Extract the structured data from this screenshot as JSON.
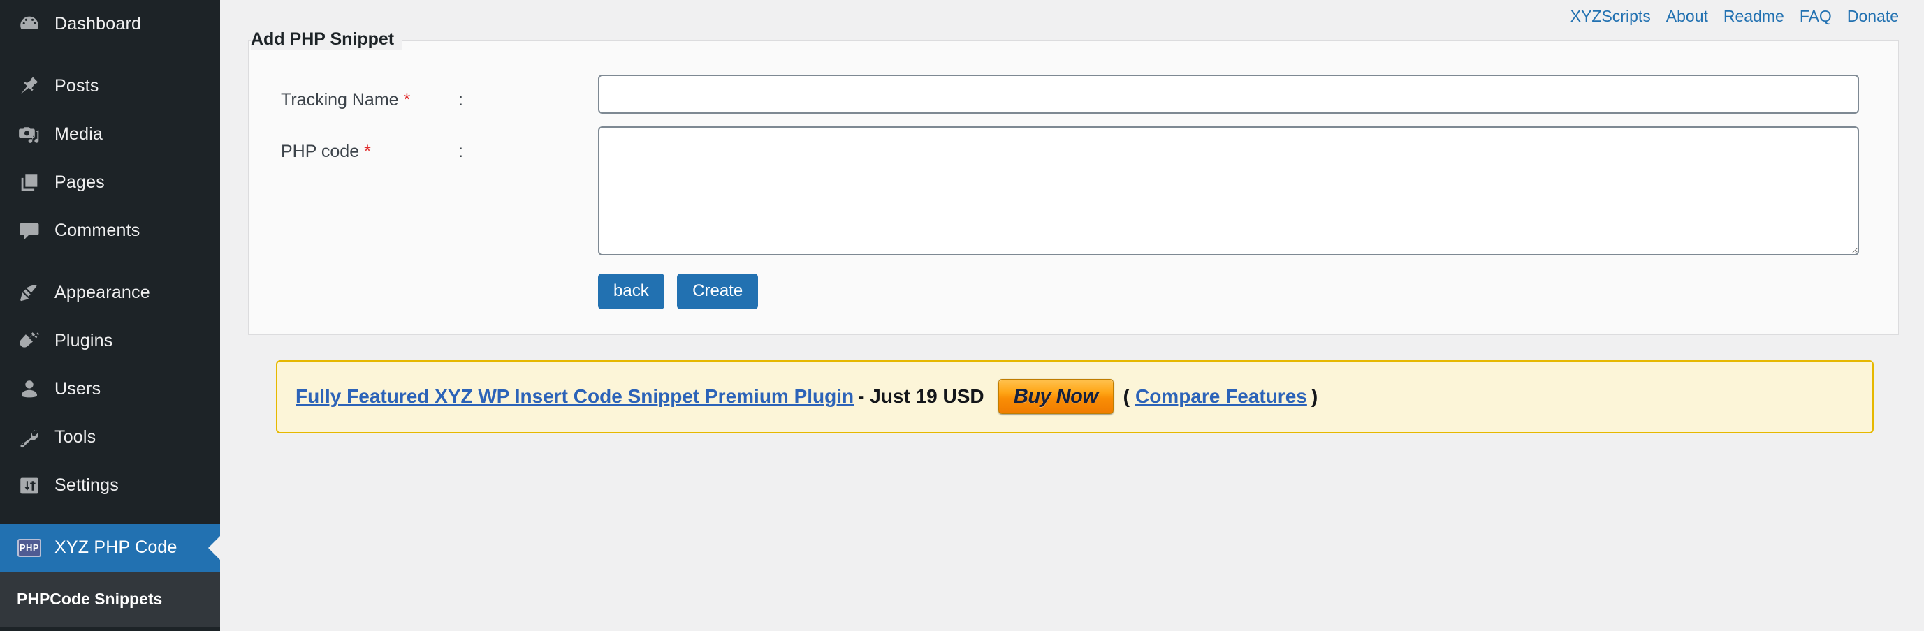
{
  "sidebar": {
    "items": [
      {
        "label": "Dashboard",
        "icon": "dashboard-icon",
        "active": false
      },
      {
        "label": "Posts",
        "icon": "pin-icon",
        "active": false
      },
      {
        "label": "Media",
        "icon": "media-icon",
        "active": false
      },
      {
        "label": "Pages",
        "icon": "pages-icon",
        "active": false
      },
      {
        "label": "Comments",
        "icon": "comments-icon",
        "active": false
      },
      {
        "label": "Appearance",
        "icon": "paintbrush-icon",
        "active": false
      },
      {
        "label": "Plugins",
        "icon": "plugin-icon",
        "active": false
      },
      {
        "label": "Users",
        "icon": "user-icon",
        "active": false
      },
      {
        "label": "Tools",
        "icon": "wrench-icon",
        "active": false
      },
      {
        "label": "Settings",
        "icon": "settings-sliders-icon",
        "active": false
      },
      {
        "label": "XYZ PHP Code",
        "icon": "php-icon",
        "active": true
      }
    ],
    "submenu": [
      {
        "label": "PHPCode Snippets"
      }
    ],
    "colors": {
      "background": "#1d2327",
      "active": "#2271b1",
      "submenu_background": "#32373c",
      "icon": "#a7aaad"
    }
  },
  "toplinks": [
    {
      "label": "XYZScripts"
    },
    {
      "label": "About"
    },
    {
      "label": "Readme"
    },
    {
      "label": "FAQ"
    },
    {
      "label": "Donate"
    }
  ],
  "panel": {
    "title": "Add PHP Snippet",
    "fields": [
      {
        "label": "Tracking Name",
        "required_marker": "*",
        "colon": ":",
        "type": "text",
        "value": "",
        "placeholder": ""
      },
      {
        "label": "PHP code",
        "required_marker": "*",
        "colon": ":",
        "type": "textarea",
        "value": "",
        "placeholder": ""
      }
    ],
    "buttons": [
      {
        "label": "back",
        "name": "back-button"
      },
      {
        "label": "Create",
        "name": "create-button"
      }
    ]
  },
  "promo": {
    "link_text": "Fully Featured XYZ WP Insert Code Snippet Premium Plugin",
    "price_text": "- Just 19 USD",
    "buy_button_label": "Buy Now",
    "open_paren": "(",
    "compare_text": "Compare Features",
    "close_paren": ")",
    "colors": {
      "background": "#fcf5d8",
      "border": "#e6b800",
      "link": "#2c63b8"
    }
  }
}
